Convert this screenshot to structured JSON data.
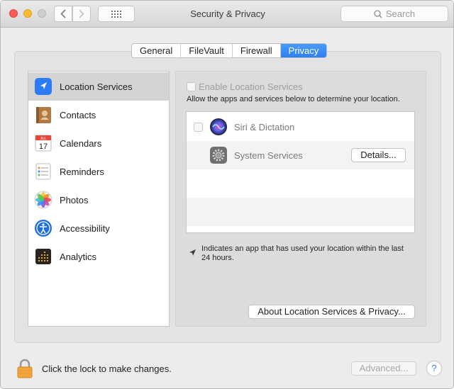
{
  "window": {
    "title": "Security & Privacy",
    "search_placeholder": "Search"
  },
  "tabs": [
    {
      "label": "General"
    },
    {
      "label": "FileVault"
    },
    {
      "label": "Firewall"
    },
    {
      "label": "Privacy",
      "selected": true
    }
  ],
  "sidebar": {
    "items": [
      {
        "label": "Location Services",
        "icon": "location-arrow-icon",
        "selected": true
      },
      {
        "label": "Contacts",
        "icon": "contacts-icon"
      },
      {
        "label": "Calendars",
        "icon": "calendar-icon",
        "icon_month": "JUL",
        "icon_day": "17"
      },
      {
        "label": "Reminders",
        "icon": "reminders-icon"
      },
      {
        "label": "Photos",
        "icon": "photos-icon"
      },
      {
        "label": "Accessibility",
        "icon": "accessibility-icon"
      },
      {
        "label": "Analytics",
        "icon": "analytics-icon"
      }
    ]
  },
  "location": {
    "enable_label": "Enable Location Services",
    "enable_checked": false,
    "allow_text": "Allow the apps and services below to determine your location.",
    "apps": [
      {
        "name": "Siri & Dictation",
        "icon": "siri-icon",
        "checked": false
      },
      {
        "name": "System Services",
        "icon": "system-services-gear-icon",
        "button": "Details..."
      }
    ],
    "hint": "Indicates an app that has used your location within the last 24 hours.",
    "about_button": "About Location Services & Privacy..."
  },
  "footer": {
    "lock_text": "Click the lock to make changes.",
    "advanced_button": "Advanced...",
    "help_button": "?"
  },
  "colors": {
    "accent": "#2f7ff0",
    "close": "#fc5b57",
    "minimize": "#fdbc2e"
  }
}
